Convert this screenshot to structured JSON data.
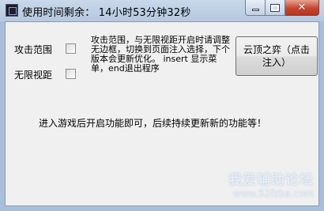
{
  "window": {
    "title": "使用时间剩余： 14小时53分钟32秒"
  },
  "options": [
    {
      "label": "攻击范围",
      "checked": false
    },
    {
      "label": "无限视距",
      "checked": false
    }
  ],
  "description": "攻击范围，与无限视距开启时请调整无边框，切换到页面注入选择，下个版本会更新优化。 insert 显示菜单，end退出程序",
  "action_button": {
    "label": "云顶之弈（点击注入）"
  },
  "status_text": "进入游戏后开启功能即可，后续持续更新新的功能等！",
  "watermark": {
    "title": "我爱辅助论坛",
    "url": "www.52fzba.com"
  },
  "icons": {
    "app": "app-icon",
    "minimize": "minimize-icon",
    "maximize": "maximize-icon",
    "close": "close-icon"
  },
  "colors": {
    "titlebar": "#b4c8df",
    "close_button": "#c5452f",
    "client_bg": "#f0f0f0"
  }
}
